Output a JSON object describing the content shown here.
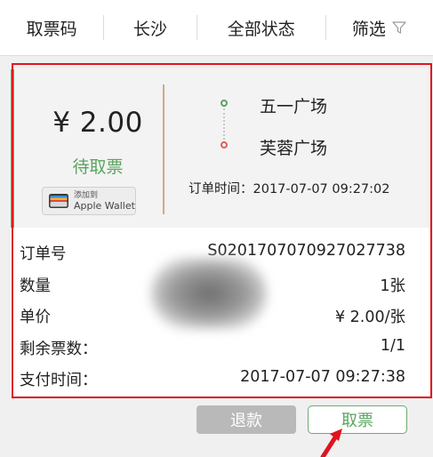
{
  "filters": {
    "code": "取票码",
    "city": "长沙",
    "status": "全部状态",
    "filter": "筛选",
    "filter_icon": "funnel-icon"
  },
  "ticket": {
    "price": "¥ 2.00",
    "status": "待取票",
    "wallet": {
      "line1": "添加到",
      "line2": "Apple Wallet"
    },
    "start_station": "五一广场",
    "end_station": "芙蓉广场",
    "order_time": "订单时间：2017-07-07 09:27:02"
  },
  "details": [
    {
      "label": "订单号",
      "value": "S0201707070927027738"
    },
    {
      "label": "数量",
      "value": "1张"
    },
    {
      "label": "单价",
      "value": "¥ 2.00/张"
    },
    {
      "label": "剩余票数：",
      "value": "1/1"
    },
    {
      "label": "支付时间：",
      "value": "2017-07-07 09:27:38"
    }
  ],
  "actions": {
    "refund": "退款",
    "take": "取票"
  },
  "colors": {
    "accent_green": "#5aa45f",
    "highlight_red": "#e0141e",
    "end_dot": "#e0605a"
  }
}
